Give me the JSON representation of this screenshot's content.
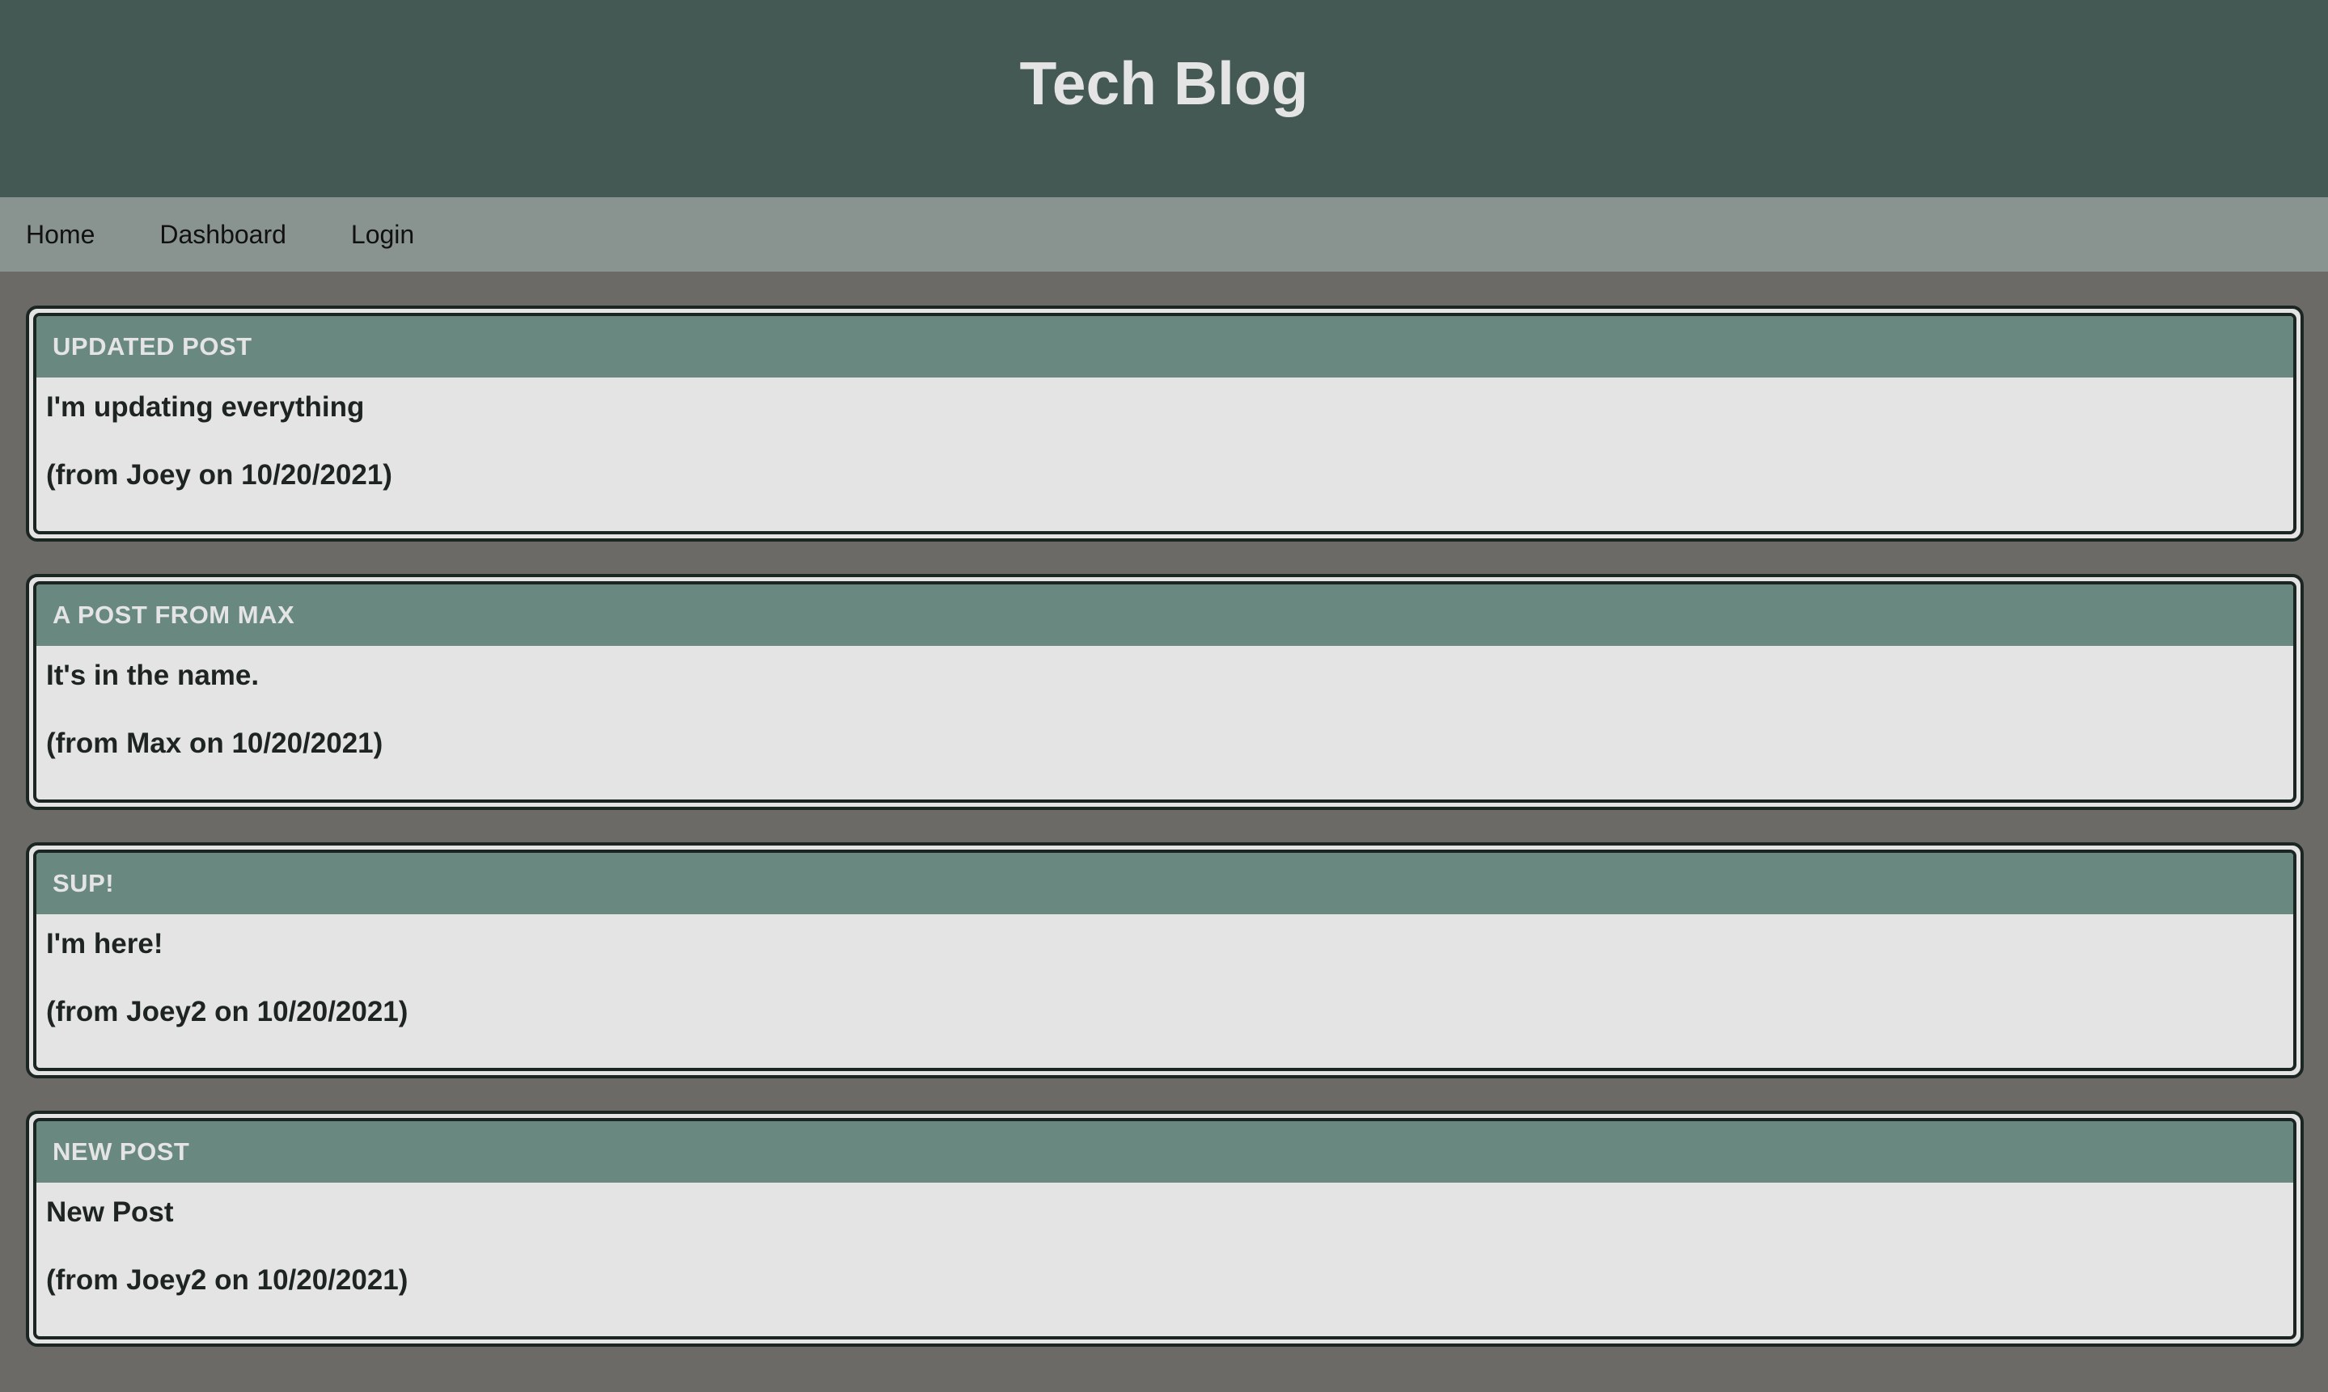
{
  "header": {
    "title": "Tech Blog"
  },
  "nav": {
    "items": [
      {
        "label": "Home"
      },
      {
        "label": "Dashboard"
      },
      {
        "label": "Login"
      }
    ]
  },
  "posts": [
    {
      "title": "UPDATED POST",
      "content": "I'm updating everything",
      "meta": "(from Joey on 10/20/2021)"
    },
    {
      "title": "A POST FROM MAX",
      "content": "It's in the name.",
      "meta": "(from Max on 10/20/2021)"
    },
    {
      "title": "SUP!",
      "content": "I'm here!",
      "meta": "(from Joey2 on 10/20/2021)"
    },
    {
      "title": "NEW POST",
      "content": "New Post",
      "meta": "(from Joey2 on 10/20/2021)"
    }
  ],
  "colors": {
    "header_bg": "#445954",
    "nav_bg": "#89938f",
    "page_bg": "#6b6a66",
    "card_header_bg": "#688880",
    "card_body_bg": "#e4e4e4"
  }
}
